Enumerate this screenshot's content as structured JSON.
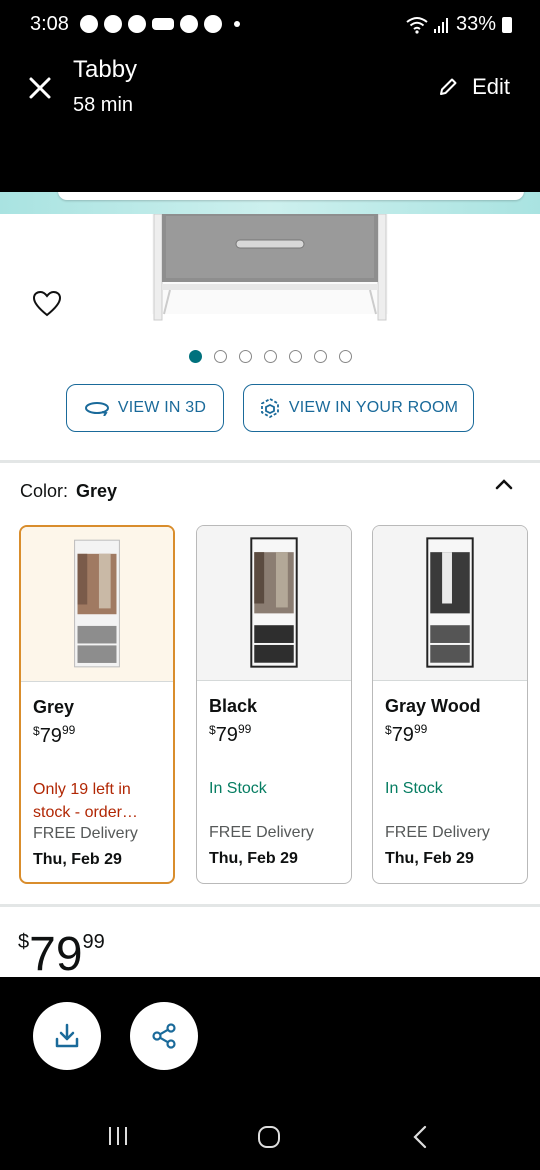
{
  "status_bar": {
    "time": "3:08",
    "battery": "33%"
  },
  "header": {
    "title": "Tabby",
    "subtitle": "58 min",
    "edit_label": "Edit"
  },
  "product": {
    "image_dots_count": 7,
    "active_dot": 0,
    "view_3d_label": "VIEW IN 3D",
    "view_room_label": "VIEW IN YOUR ROOM",
    "color_label": "Color:",
    "color_value": "Grey",
    "variants": [
      {
        "name": "Grey",
        "price_currency": "$",
        "price_whole": "79",
        "price_fraction": "99",
        "stock": "Only 19 left in stock - order…",
        "stock_status": "low",
        "delivery_label": "FREE Delivery",
        "delivery_date": "Thu, Feb 29",
        "selected": true
      },
      {
        "name": "Black",
        "price_currency": "$",
        "price_whole": "79",
        "price_fraction": "99",
        "stock": "In Stock",
        "stock_status": "in",
        "delivery_label": "FREE Delivery",
        "delivery_date": "Thu, Feb 29",
        "selected": false
      },
      {
        "name": "Gray Wood",
        "price_currency": "$",
        "price_whole": "79",
        "price_fraction": "99",
        "stock": "In Stock",
        "stock_status": "in",
        "delivery_label": "FREE Delivery",
        "delivery_date": "Thu, Feb 29",
        "selected": false
      }
    ],
    "price_currency": "$",
    "price_whole": "79",
    "price_fraction": "99"
  },
  "colors": {
    "accent_teal": "#00717d",
    "link_blue": "#1a6a9a",
    "selected_border": "#d98d2c",
    "stock_low": "#b12704",
    "stock_in": "#067d62"
  },
  "icons": {
    "close": "close-icon",
    "edit": "pencil-icon",
    "heart": "heart-icon",
    "view_3d": "rotate-3d-icon",
    "view_room": "ar-cube-icon",
    "chevron": "chevron-up-icon",
    "download": "download-icon",
    "share": "share-icon"
  }
}
